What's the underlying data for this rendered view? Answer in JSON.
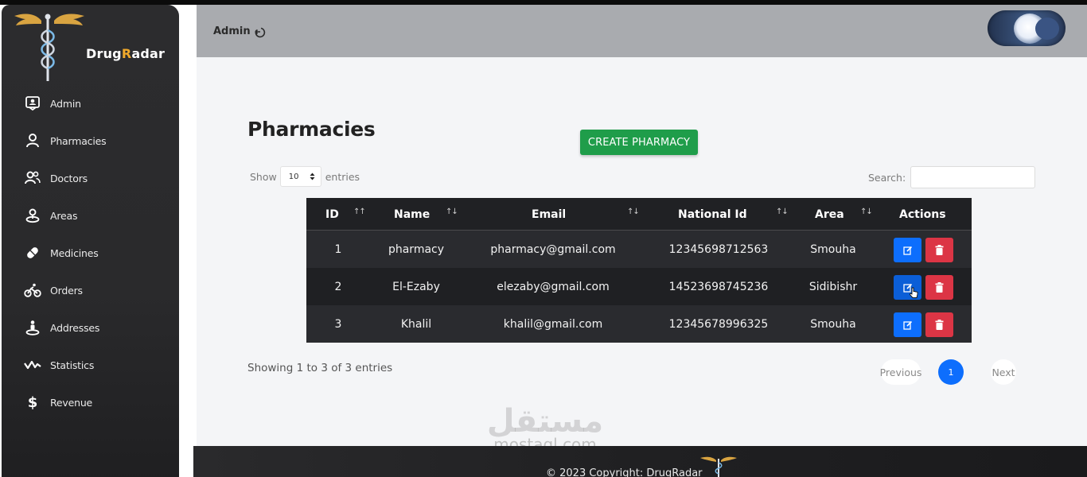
{
  "brand": {
    "name_part1": "Drug",
    "name_accent": "R",
    "name_part2": "adar"
  },
  "sidebar": {
    "items": [
      {
        "label": "Admin",
        "icon": "admin-badge-icon"
      },
      {
        "label": "Pharmacies",
        "icon": "user-icon"
      },
      {
        "label": "Doctors",
        "icon": "users-icon"
      },
      {
        "label": "Areas",
        "icon": "map-pin-icon"
      },
      {
        "label": "Medicines",
        "icon": "pill-icon"
      },
      {
        "label": "Orders",
        "icon": "bicycle-icon"
      },
      {
        "label": "Addresses",
        "icon": "location-person-icon"
      },
      {
        "label": "Statistics",
        "icon": "wave-chart-icon"
      },
      {
        "label": "Revenue",
        "icon": "dollar-icon"
      }
    ]
  },
  "header": {
    "user_label": "Admin",
    "logout_icon": "logout-icon",
    "theme_toggle": "dark-mode-toggle"
  },
  "main": {
    "title": "Pharmacies",
    "create_button": "CREATE PHARMACY",
    "show_label": "Show",
    "entries_label": "entries",
    "page_size": "10",
    "search_label": "Search:",
    "search_value": ""
  },
  "table": {
    "headers": [
      "ID",
      "Name",
      "Email",
      "National Id",
      "Area",
      "Actions"
    ],
    "rows": [
      {
        "id": "1",
        "name": "pharmacy",
        "email": "pharmacy@gmail.com",
        "national_id": "12345698712563",
        "area": "Smouha"
      },
      {
        "id": "2",
        "name": "El-Ezaby",
        "email": "elezaby@gmail.com",
        "national_id": "14523698745236",
        "area": "Sidibishr"
      },
      {
        "id": "3",
        "name": "Khalil",
        "email": "khalil@gmail.com",
        "national_id": "12345678996325",
        "area": "Smouha"
      }
    ]
  },
  "pagination": {
    "info": "Showing 1 to 3 of 3 entries",
    "previous": "Previous",
    "current_page": "1",
    "next": "Next"
  },
  "footer": {
    "text": "© 2023 Copyright: DrugRadar"
  },
  "watermark": {
    "arabic": "مستقل",
    "latin": "mostaql.com"
  },
  "colors": {
    "sidebar_bg": "#2c2c2e",
    "header_bg": "#a9abaf",
    "create_button": "#1f9d4a",
    "edit_button": "#0d6efd",
    "delete_button": "#dc3545",
    "brand_accent": "#f0a92b",
    "table_bg": "#1f2023"
  }
}
